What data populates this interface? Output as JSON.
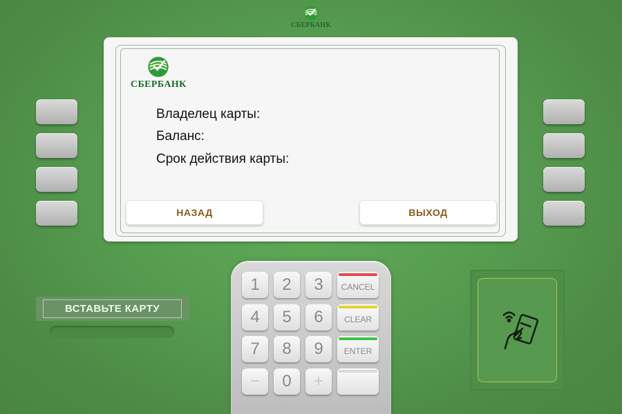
{
  "brand": {
    "name": "СБЕРБАНК",
    "green": "#1b6b2a",
    "icon": "sberbank-logo-icon"
  },
  "screen": {
    "fields": {
      "owner_label": "Владелец карты:",
      "balance_label": "Баланс:",
      "expiry_label": "Срок действия карты:"
    },
    "buttons": {
      "back": "НАЗАД",
      "exit": "ВЫХОД"
    }
  },
  "card_slot": {
    "label": "ВСТАВЬТЕ КАРТУ"
  },
  "keypad": {
    "keys": [
      "1",
      "2",
      "3",
      "4",
      "5",
      "6",
      "7",
      "8",
      "9",
      "−",
      "0",
      "+"
    ],
    "function_keys": {
      "cancel": {
        "label": "CANCEL",
        "color": "#e5484d"
      },
      "clear": {
        "label": "CLEAR",
        "color": "#e5d22c"
      },
      "enter": {
        "label": "ENTER",
        "color": "#3ec34a"
      },
      "blank": {
        "label": "",
        "color": "#d8d8d8"
      }
    }
  },
  "contactless": {
    "icon": "contactless-card-icon"
  },
  "colors": {
    "background": "#5aa153",
    "button_text": "#8b5a18"
  }
}
